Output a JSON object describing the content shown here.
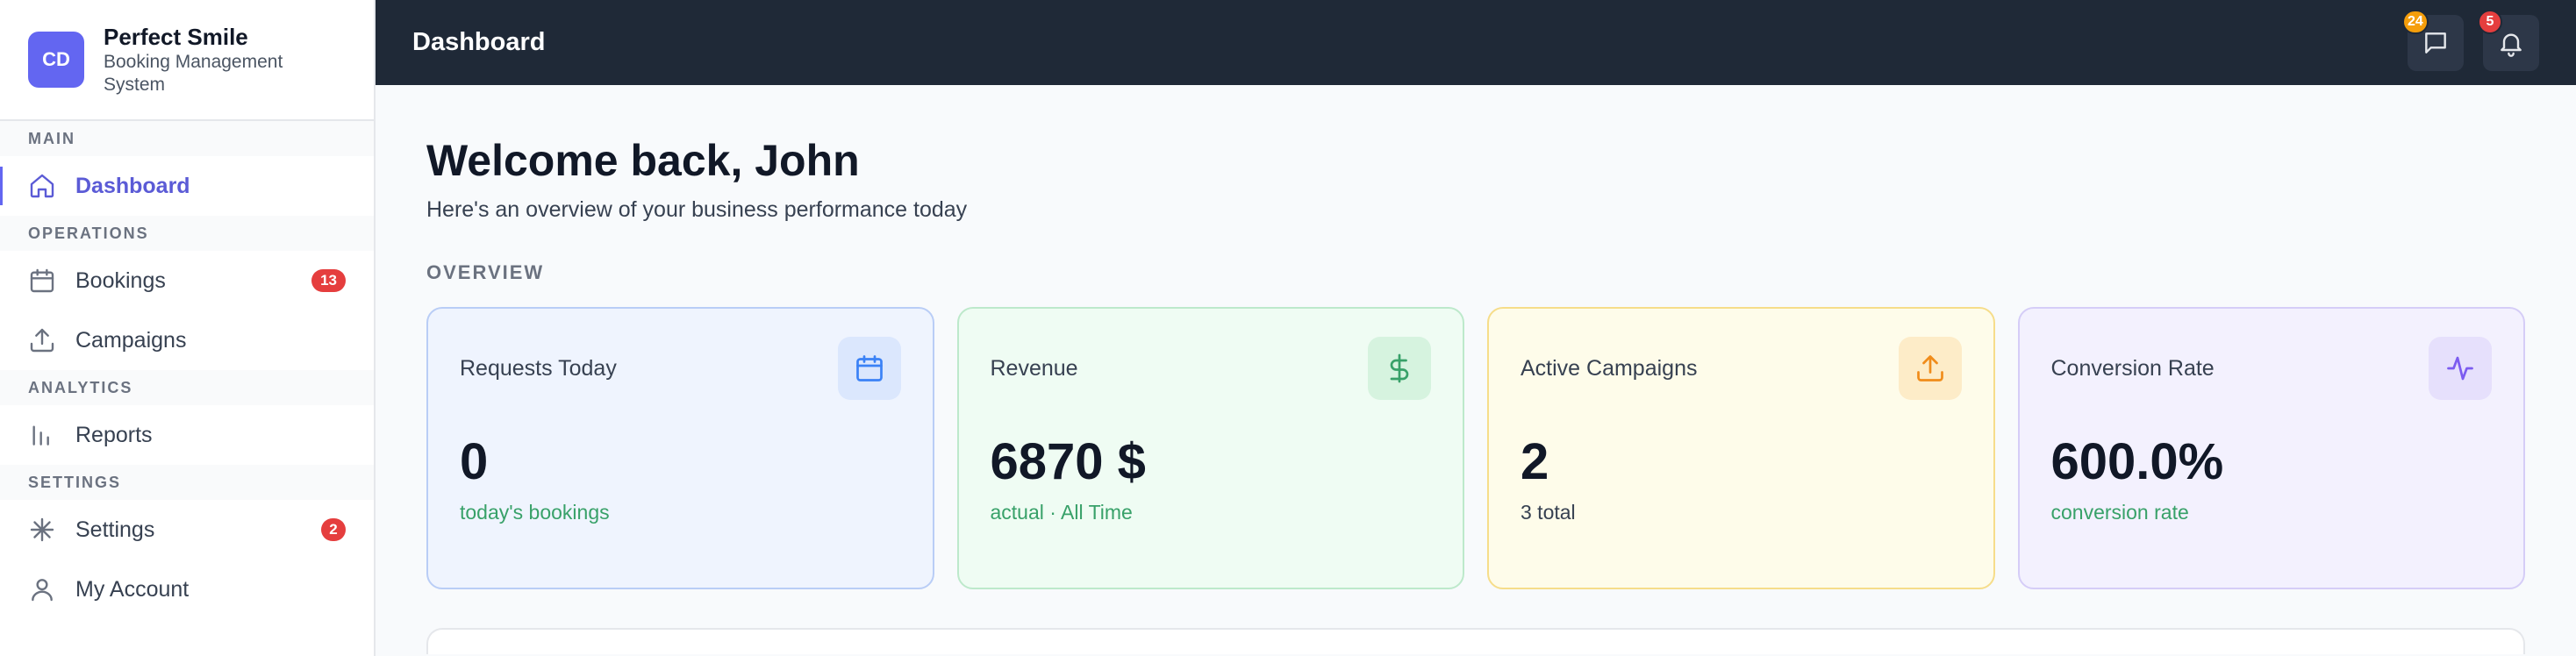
{
  "brand": {
    "initials": "CD",
    "name": "Perfect Smile",
    "subtitle": "Booking Management System"
  },
  "sidebar": {
    "sections": {
      "main": "MAIN",
      "operations": "OPERATIONS",
      "analytics": "ANALYTICS",
      "settings": "SETTINGS"
    },
    "items": {
      "dashboard": {
        "label": "Dashboard",
        "icon": "home-icon"
      },
      "bookings": {
        "label": "Bookings",
        "icon": "calendar-icon",
        "badge": "13"
      },
      "campaigns": {
        "label": "Campaigns",
        "icon": "upload-icon"
      },
      "reports": {
        "label": "Reports",
        "icon": "bar-chart-icon"
      },
      "settings": {
        "label": "Settings",
        "icon": "sparkle-settings-icon",
        "badge": "2"
      },
      "account": {
        "label": "My Account",
        "icon": "user-icon"
      }
    }
  },
  "topbar": {
    "title": "Dashboard",
    "messages_badge": "24",
    "notifications_badge": "5"
  },
  "welcome": {
    "title": "Welcome back, John",
    "subtitle": "Here's an overview of your business performance today"
  },
  "overview": {
    "label": "OVERVIEW",
    "cards": [
      {
        "title": "Requests Today",
        "value": "0",
        "sub": "today's bookings",
        "icon": "calendar-icon",
        "accent": "#3b82f6"
      },
      {
        "title": "Revenue",
        "value": "6870 $",
        "sub": "actual · All Time",
        "icon": "dollar-icon",
        "accent": "#38a169"
      },
      {
        "title": "Active Campaigns",
        "value": "2",
        "sub": "3 total",
        "icon": "upload-icon",
        "accent": "#f59e0b"
      },
      {
        "title": "Conversion Rate",
        "value": "600.0%",
        "sub": "conversion rate",
        "icon": "activity-icon",
        "accent": "#7c5cf0"
      }
    ]
  }
}
